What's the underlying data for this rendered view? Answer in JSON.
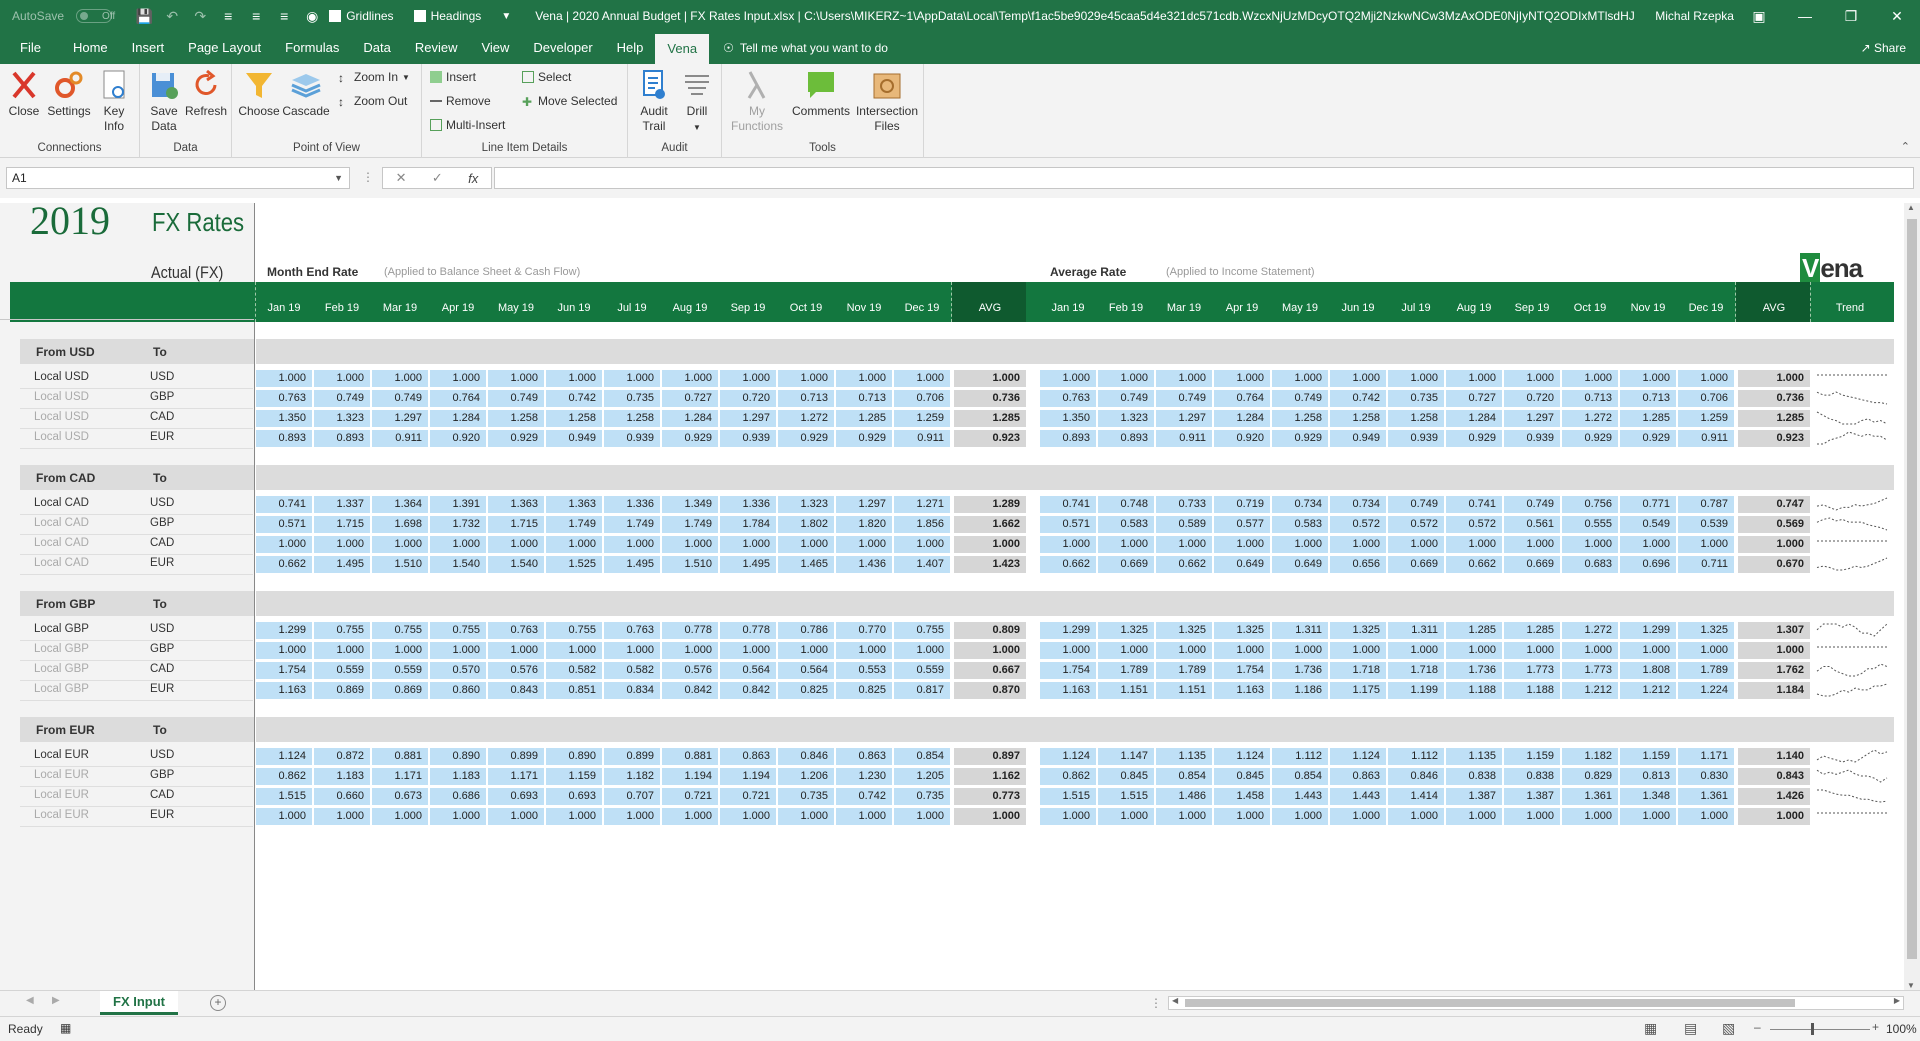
{
  "titlebar": {
    "autosave_label": "AutoSave",
    "autosave_state": "Off",
    "gridlines_label": "Gridlines",
    "headings_label": "Headings",
    "title": "Vena | 2020 Annual Budget | FX Rates Input.xlsx | C:\\Users\\MIKERZ~1\\AppData\\Local\\Temp\\f1ac5be9029e45caa5d4e321dc571cdb.WzcxNjUzMDcyOTQ2Mji2NzkwNCw3MzAxODE0NjIyNTQ2ODIxMTlsdHJ1ZSwi...",
    "user": "Michal Rzepka"
  },
  "menu": {
    "tabs": [
      "File",
      "Home",
      "Insert",
      "Page Layout",
      "Formulas",
      "Data",
      "Review",
      "View",
      "Developer",
      "Help",
      "Vena"
    ],
    "active": "Vena",
    "tell_me": "Tell me what you want to do",
    "share": "Share"
  },
  "ribbon": {
    "connections": {
      "label": "Connections",
      "close": "Close",
      "settings": "Settings",
      "key_info_1": "Key",
      "key_info_2": "Info"
    },
    "data": {
      "label": "Data",
      "save_1": "Save",
      "save_2": "Data",
      "refresh": "Refresh"
    },
    "pov": {
      "label": "Point of View",
      "choose": "Choose",
      "cascade": "Cascade",
      "zoom_in": "Zoom In",
      "zoom_out": "Zoom Out"
    },
    "lid": {
      "label": "Line Item Details",
      "insert": "Insert",
      "remove": "Remove",
      "multi_insert": "Multi-Insert",
      "select": "Select",
      "move_selected": "Move Selected"
    },
    "audit": {
      "label": "Audit",
      "audit_trail_1": "Audit",
      "audit_trail_2": "Trail",
      "drill": "Drill"
    },
    "tools": {
      "label": "Tools",
      "my_functions_1": "My",
      "my_functions_2": "Functions",
      "comments": "Comments",
      "intersection_1": "Intersection",
      "intersection_2": "Files"
    }
  },
  "formula_bar": {
    "name_box": "A1",
    "formula": ""
  },
  "sheet": {
    "year": "2019",
    "title": "FX Rates",
    "actual": "Actual (FX)",
    "month_end": {
      "title": "Month End Rate",
      "subtitle": "(Applied to Balance Sheet & Cash Flow)"
    },
    "average": {
      "title": "Average Rate",
      "subtitle": "(Applied to Income Statement)"
    },
    "logo_v": "V",
    "logo_rest": "ena",
    "months": [
      "Jan 19",
      "Feb 19",
      "Mar 19",
      "Apr 19",
      "May 19",
      "Jun 19",
      "Jul 19",
      "Aug 19",
      "Sep 19",
      "Oct 19",
      "Nov 19",
      "Dec 19"
    ],
    "avg_label": "AVG",
    "trend_label": "Trend",
    "to_label": "To",
    "groups": [
      {
        "from": "From USD",
        "rows": [
          {
            "label": "Local USD",
            "to": "USD",
            "dim": false,
            "me": [
              "1.000",
              "1.000",
              "1.000",
              "1.000",
              "1.000",
              "1.000",
              "1.000",
              "1.000",
              "1.000",
              "1.000",
              "1.000",
              "1.000"
            ],
            "me_avg": "1.000",
            "ar": [
              "1.000",
              "1.000",
              "1.000",
              "1.000",
              "1.000",
              "1.000",
              "1.000",
              "1.000",
              "1.000",
              "1.000",
              "1.000",
              "1.000"
            ],
            "ar_avg": "1.000"
          },
          {
            "label": "Local USD",
            "to": "GBP",
            "dim": true,
            "me": [
              "0.763",
              "0.749",
              "0.749",
              "0.764",
              "0.749",
              "0.742",
              "0.735",
              "0.727",
              "0.720",
              "0.713",
              "0.713",
              "0.706"
            ],
            "me_avg": "0.736",
            "ar": [
              "0.763",
              "0.749",
              "0.749",
              "0.764",
              "0.749",
              "0.742",
              "0.735",
              "0.727",
              "0.720",
              "0.713",
              "0.713",
              "0.706"
            ],
            "ar_avg": "0.736"
          },
          {
            "label": "Local USD",
            "to": "CAD",
            "dim": true,
            "me": [
              "1.350",
              "1.323",
              "1.297",
              "1.284",
              "1.258",
              "1.258",
              "1.258",
              "1.284",
              "1.297",
              "1.272",
              "1.285",
              "1.259"
            ],
            "me_avg": "1.285",
            "ar": [
              "1.350",
              "1.323",
              "1.297",
              "1.284",
              "1.258",
              "1.258",
              "1.258",
              "1.284",
              "1.297",
              "1.272",
              "1.285",
              "1.259"
            ],
            "ar_avg": "1.285"
          },
          {
            "label": "Local USD",
            "to": "EUR",
            "dim": true,
            "me": [
              "0.893",
              "0.893",
              "0.911",
              "0.920",
              "0.929",
              "0.949",
              "0.939",
              "0.929",
              "0.939",
              "0.929",
              "0.929",
              "0.911"
            ],
            "me_avg": "0.923",
            "ar": [
              "0.893",
              "0.893",
              "0.911",
              "0.920",
              "0.929",
              "0.949",
              "0.939",
              "0.929",
              "0.939",
              "0.929",
              "0.929",
              "0.911"
            ],
            "ar_avg": "0.923"
          }
        ]
      },
      {
        "from": "From CAD",
        "rows": [
          {
            "label": "Local CAD",
            "to": "USD",
            "dim": false,
            "me": [
              "0.741",
              "1.337",
              "1.364",
              "1.391",
              "1.363",
              "1.363",
              "1.336",
              "1.349",
              "1.336",
              "1.323",
              "1.297",
              "1.271"
            ],
            "me_avg": "1.289",
            "ar": [
              "0.741",
              "0.748",
              "0.733",
              "0.719",
              "0.734",
              "0.734",
              "0.749",
              "0.741",
              "0.749",
              "0.756",
              "0.771",
              "0.787"
            ],
            "ar_avg": "0.747"
          },
          {
            "label": "Local CAD",
            "to": "GBP",
            "dim": true,
            "me": [
              "0.571",
              "1.715",
              "1.698",
              "1.732",
              "1.715",
              "1.749",
              "1.749",
              "1.749",
              "1.784",
              "1.802",
              "1.820",
              "1.856"
            ],
            "me_avg": "1.662",
            "ar": [
              "0.571",
              "0.583",
              "0.589",
              "0.577",
              "0.583",
              "0.572",
              "0.572",
              "0.572",
              "0.561",
              "0.555",
              "0.549",
              "0.539"
            ],
            "ar_avg": "0.569"
          },
          {
            "label": "Local CAD",
            "to": "CAD",
            "dim": true,
            "me": [
              "1.000",
              "1.000",
              "1.000",
              "1.000",
              "1.000",
              "1.000",
              "1.000",
              "1.000",
              "1.000",
              "1.000",
              "1.000",
              "1.000"
            ],
            "me_avg": "1.000",
            "ar": [
              "1.000",
              "1.000",
              "1.000",
              "1.000",
              "1.000",
              "1.000",
              "1.000",
              "1.000",
              "1.000",
              "1.000",
              "1.000",
              "1.000"
            ],
            "ar_avg": "1.000"
          },
          {
            "label": "Local CAD",
            "to": "EUR",
            "dim": true,
            "me": [
              "0.662",
              "1.495",
              "1.510",
              "1.540",
              "1.540",
              "1.525",
              "1.495",
              "1.510",
              "1.495",
              "1.465",
              "1.436",
              "1.407"
            ],
            "me_avg": "1.423",
            "ar": [
              "0.662",
              "0.669",
              "0.662",
              "0.649",
              "0.649",
              "0.656",
              "0.669",
              "0.662",
              "0.669",
              "0.683",
              "0.696",
              "0.711"
            ],
            "ar_avg": "0.670"
          }
        ]
      },
      {
        "from": "From GBP",
        "rows": [
          {
            "label": "Local GBP",
            "to": "USD",
            "dim": false,
            "me": [
              "1.299",
              "0.755",
              "0.755",
              "0.755",
              "0.763",
              "0.755",
              "0.763",
              "0.778",
              "0.778",
              "0.786",
              "0.770",
              "0.755"
            ],
            "me_avg": "0.809",
            "ar": [
              "1.299",
              "1.325",
              "1.325",
              "1.325",
              "1.311",
              "1.325",
              "1.311",
              "1.285",
              "1.285",
              "1.272",
              "1.299",
              "1.325"
            ],
            "ar_avg": "1.307"
          },
          {
            "label": "Local GBP",
            "to": "GBP",
            "dim": true,
            "me": [
              "1.000",
              "1.000",
              "1.000",
              "1.000",
              "1.000",
              "1.000",
              "1.000",
              "1.000",
              "1.000",
              "1.000",
              "1.000",
              "1.000"
            ],
            "me_avg": "1.000",
            "ar": [
              "1.000",
              "1.000",
              "1.000",
              "1.000",
              "1.000",
              "1.000",
              "1.000",
              "1.000",
              "1.000",
              "1.000",
              "1.000",
              "1.000"
            ],
            "ar_avg": "1.000"
          },
          {
            "label": "Local GBP",
            "to": "CAD",
            "dim": true,
            "me": [
              "1.754",
              "0.559",
              "0.559",
              "0.570",
              "0.576",
              "0.582",
              "0.582",
              "0.576",
              "0.564",
              "0.564",
              "0.553",
              "0.559"
            ],
            "me_avg": "0.667",
            "ar": [
              "1.754",
              "1.789",
              "1.789",
              "1.754",
              "1.736",
              "1.718",
              "1.718",
              "1.736",
              "1.773",
              "1.773",
              "1.808",
              "1.789"
            ],
            "ar_avg": "1.762"
          },
          {
            "label": "Local GBP",
            "to": "EUR",
            "dim": true,
            "me": [
              "1.163",
              "0.869",
              "0.869",
              "0.860",
              "0.843",
              "0.851",
              "0.834",
              "0.842",
              "0.842",
              "0.825",
              "0.825",
              "0.817"
            ],
            "me_avg": "0.870",
            "ar": [
              "1.163",
              "1.151",
              "1.151",
              "1.163",
              "1.186",
              "1.175",
              "1.199",
              "1.188",
              "1.188",
              "1.212",
              "1.212",
              "1.224"
            ],
            "ar_avg": "1.184"
          }
        ]
      },
      {
        "from": "From EUR",
        "rows": [
          {
            "label": "Local EUR",
            "to": "USD",
            "dim": false,
            "me": [
              "1.124",
              "0.872",
              "0.881",
              "0.890",
              "0.899",
              "0.890",
              "0.899",
              "0.881",
              "0.863",
              "0.846",
              "0.863",
              "0.854"
            ],
            "me_avg": "0.897",
            "ar": [
              "1.124",
              "1.147",
              "1.135",
              "1.124",
              "1.112",
              "1.124",
              "1.112",
              "1.135",
              "1.159",
              "1.182",
              "1.159",
              "1.171"
            ],
            "ar_avg": "1.140"
          },
          {
            "label": "Local EUR",
            "to": "GBP",
            "dim": true,
            "me": [
              "0.862",
              "1.183",
              "1.171",
              "1.183",
              "1.171",
              "1.159",
              "1.182",
              "1.194",
              "1.194",
              "1.206",
              "1.230",
              "1.205"
            ],
            "me_avg": "1.162",
            "ar": [
              "0.862",
              "0.845",
              "0.854",
              "0.845",
              "0.854",
              "0.863",
              "0.846",
              "0.838",
              "0.838",
              "0.829",
              "0.813",
              "0.830"
            ],
            "ar_avg": "0.843"
          },
          {
            "label": "Local EUR",
            "to": "CAD",
            "dim": true,
            "me": [
              "1.515",
              "0.660",
              "0.673",
              "0.686",
              "0.693",
              "0.693",
              "0.707",
              "0.721",
              "0.721",
              "0.735",
              "0.742",
              "0.735"
            ],
            "me_avg": "0.773",
            "ar": [
              "1.515",
              "1.515",
              "1.486",
              "1.458",
              "1.443",
              "1.443",
              "1.414",
              "1.387",
              "1.387",
              "1.361",
              "1.348",
              "1.361"
            ],
            "ar_avg": "1.426"
          },
          {
            "label": "Local EUR",
            "to": "EUR",
            "dim": true,
            "me": [
              "1.000",
              "1.000",
              "1.000",
              "1.000",
              "1.000",
              "1.000",
              "1.000",
              "1.000",
              "1.000",
              "1.000",
              "1.000",
              "1.000"
            ],
            "me_avg": "1.000",
            "ar": [
              "1.000",
              "1.000",
              "1.000",
              "1.000",
              "1.000",
              "1.000",
              "1.000",
              "1.000",
              "1.000",
              "1.000",
              "1.000",
              "1.000"
            ],
            "ar_avg": "1.000"
          }
        ]
      }
    ]
  },
  "tabs": {
    "sheet": "FX Input"
  },
  "status": {
    "ready": "Ready",
    "zoom": "100%"
  },
  "colors": {
    "excel_green": "#217346",
    "header_green": "#13773f",
    "input_blue": "#bfe0f6"
  }
}
